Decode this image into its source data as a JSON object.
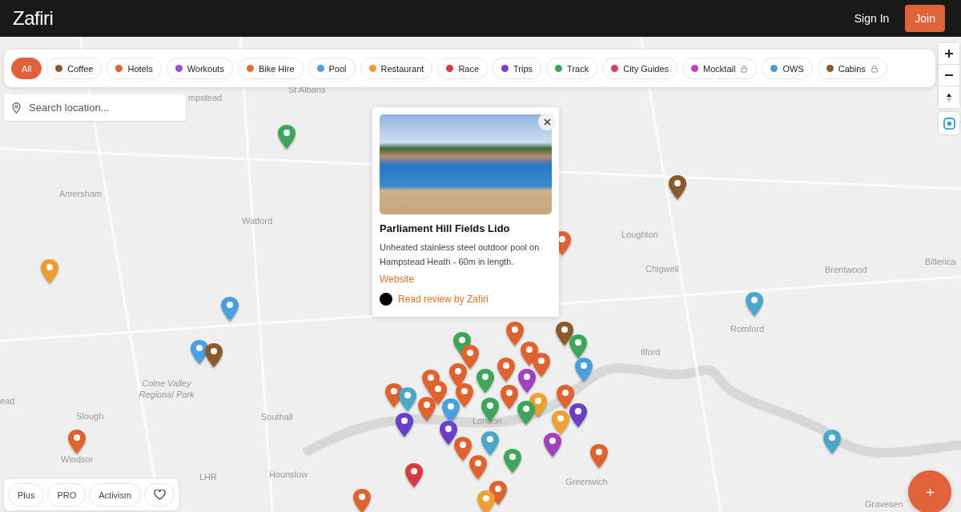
{
  "header": {
    "logo": "Zafiri",
    "sign_in": "Sign In",
    "join": "Join"
  },
  "filters": [
    {
      "label": "All",
      "selected": true,
      "locked": false
    },
    {
      "label": "Coffee",
      "color": "#8b5a2b",
      "selected": false,
      "locked": false
    },
    {
      "label": "Hotels",
      "color": "#e0622e",
      "selected": false,
      "locked": false
    },
    {
      "label": "Workouts",
      "color": "#9b4fd0",
      "selected": false,
      "locked": false
    },
    {
      "label": "Bike Hire",
      "color": "#e0722e",
      "selected": false,
      "locked": false
    },
    {
      "label": "Pool",
      "color": "#4a9fe0",
      "selected": false,
      "locked": false
    },
    {
      "label": "Restaurant",
      "color": "#f09a30",
      "selected": false,
      "locked": false
    },
    {
      "label": "Race",
      "color": "#d63c3c",
      "selected": false,
      "locked": false
    },
    {
      "label": "Trips",
      "color": "#7b3fd0",
      "selected": false,
      "locked": false
    },
    {
      "label": "Track",
      "color": "#3fa55a",
      "selected": false,
      "locked": false
    },
    {
      "label": "City Guides",
      "color": "#d63c6a",
      "selected": false,
      "locked": false
    },
    {
      "label": "Mocktail",
      "color": "#c040c0",
      "selected": false,
      "locked": true
    },
    {
      "label": "OWS",
      "color": "#4a9ccc",
      "selected": false,
      "locked": false
    },
    {
      "label": "Cabins",
      "color": "#8b5a2b",
      "selected": false,
      "locked": true
    }
  ],
  "search": {
    "placeholder": "Search location..."
  },
  "place_labels": [
    "St Albans",
    "mpstead",
    "Amersham",
    "Watford",
    "Loughton",
    "Chigwell",
    "Brentwood",
    "Billerica",
    "Romford",
    "Ilford",
    "Colne Valley Regional Park",
    "Slough",
    "Southall",
    "Windsor",
    "ead",
    "LHR",
    "Hounslow",
    "London",
    "Greenwich",
    "Gravesen"
  ],
  "pins": [
    {
      "color": "#3fa55a"
    },
    {
      "color": "#8b5a2b"
    },
    {
      "color": "#e0622e"
    },
    {
      "color": "#f09a30"
    },
    {
      "color": "#4a9fe0"
    },
    {
      "color": "#4a9fe0"
    },
    {
      "color": "#8b5a2b"
    },
    {
      "color": "#4aa8c8"
    },
    {
      "color": "#e0622e"
    },
    {
      "color": "#8b5a2b"
    },
    {
      "color": "#3fa55a"
    },
    {
      "color": "#3fa55a"
    },
    {
      "color": "#e0622e"
    },
    {
      "color": "#e0622e"
    },
    {
      "color": "#e0622e"
    },
    {
      "color": "#4a9fe0"
    },
    {
      "color": "#e0622e"
    },
    {
      "color": "#e0622e"
    },
    {
      "color": "#e0622e"
    },
    {
      "color": "#3fa55a"
    },
    {
      "color": "#a040c0"
    },
    {
      "color": "#f0a030"
    },
    {
      "color": "#e0622e"
    },
    {
      "color": "#4aa8c8"
    },
    {
      "color": "#e0622e"
    },
    {
      "color": "#e0622e"
    },
    {
      "color": "#3fa55a"
    },
    {
      "color": "#e0622e"
    },
    {
      "color": "#e0622e"
    },
    {
      "color": "#4a9fe0"
    },
    {
      "color": "#e0622e"
    },
    {
      "color": "#6a3fc8"
    },
    {
      "color": "#f0a030"
    },
    {
      "color": "#6a3fc8"
    },
    {
      "color": "#a040c0"
    },
    {
      "color": "#6a3fc8"
    },
    {
      "color": "#4aa8c8"
    },
    {
      "color": "#e0622e"
    },
    {
      "color": "#e0622e"
    },
    {
      "color": "#e0622e"
    },
    {
      "color": "#d63c3c"
    },
    {
      "color": "#e0622e"
    },
    {
      "color": "#3fa55a"
    },
    {
      "color": "#e0622e"
    },
    {
      "color": "#e0622e"
    },
    {
      "color": "#f0a030"
    },
    {
      "color": "#4aa8c8"
    },
    {
      "color": "#3fa55a"
    }
  ],
  "popup": {
    "title": "Parliament Hill Fields Lido",
    "description": "Unheated stainless steel outdoor pool on Hampstead Heath - 60m in length.",
    "website": "Website",
    "review": "Read review by Zafiri"
  },
  "bottom_tabs": [
    "Plus",
    "PRO",
    "Activism"
  ]
}
